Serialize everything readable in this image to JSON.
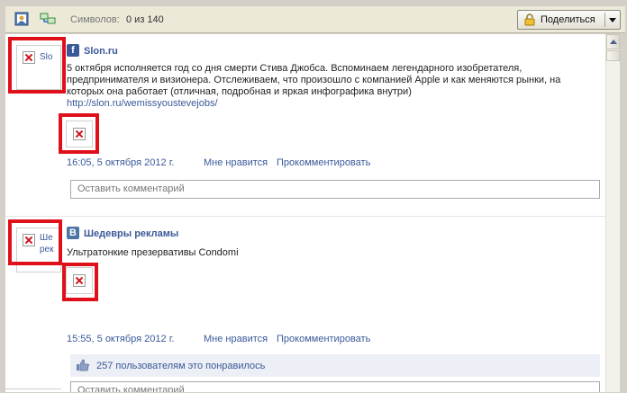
{
  "toolbar": {
    "chars_label": "Символов:",
    "chars_count": "0 из 140",
    "share_label": "Поделиться",
    "icons": [
      "profile-icon",
      "network-icon",
      "lock-icon",
      "dropdown-arrow-icon"
    ]
  },
  "posts": [
    {
      "avatar_alt": "Slo",
      "source_icon": "facebook-icon",
      "source_name": "Slon.ru",
      "text": "5 октября исполняется год со дня смерти Стива Джобса. Вспоминаем легендарного изобретателя, предпринимателя и визионера. Отслеживаем, что произошло с компанией Apple и как меняются рынки, на которых она работает (отличная, подробная и яркая инфографика внутри)",
      "link": "http://slon.ru/wemissyoustevejobs/",
      "time": "16:05, 5 октября 2012 г.",
      "like_label": "Мне нравится",
      "comment_label": "Прокомментировать",
      "comment_placeholder": "Оставить комментарий"
    },
    {
      "avatar_alt_line1": "Ше",
      "avatar_alt_line2": "рек",
      "source_icon": "vkontakte-icon",
      "source_name": "Шедевры рекламы",
      "text": "Ультратонкие презервативы Condomi",
      "time": "15:55, 5 октября 2012 г.",
      "like_label": "Мне нравится",
      "comment_label": "Прокомментировать",
      "likes_text": "257 пользователям это понравилось",
      "comment_placeholder": "Оставить комментарий"
    }
  ],
  "colors": {
    "link": "#3b5998",
    "highlight": "#e0101a",
    "facebook": "#3b5998",
    "vkontakte": "#4c75a3"
  }
}
